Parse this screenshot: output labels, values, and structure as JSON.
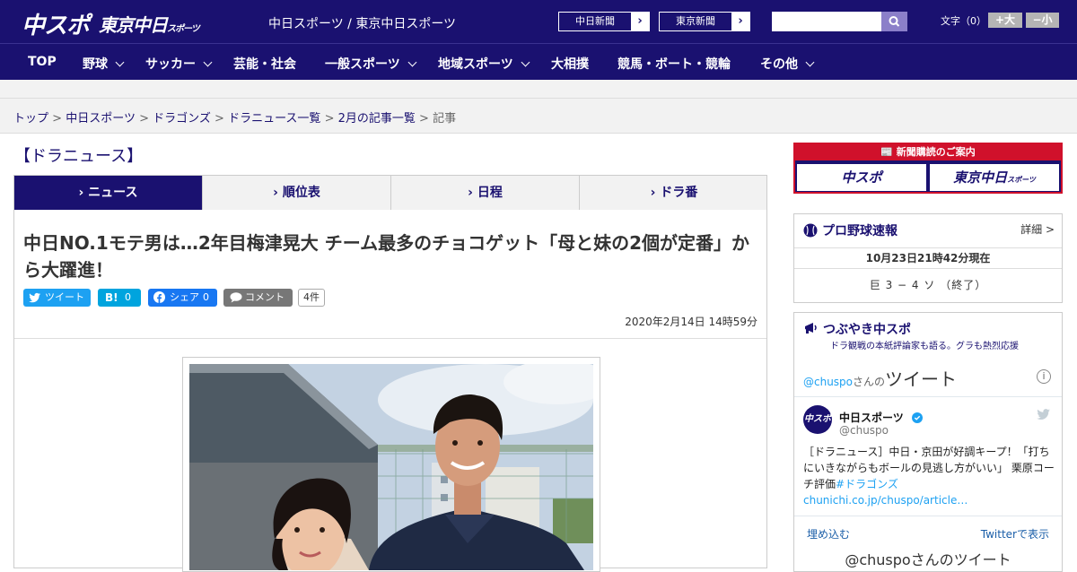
{
  "header": {
    "logo_main": "中スポ",
    "logo_sub": "東京中日",
    "logo_sub_small": "スポーツ",
    "tagline": "中日スポーツ / 東京中日スポーツ",
    "paper_links": [
      "中日新聞",
      "東京新聞"
    ],
    "search_placeholder": "",
    "font_size_label": "文字（0）",
    "font_larger": "+大",
    "font_smaller": "−小"
  },
  "nav": {
    "items": [
      {
        "label": "TOP",
        "has_menu": false
      },
      {
        "label": "野球",
        "has_menu": true
      },
      {
        "label": "サッカー",
        "has_menu": true
      },
      {
        "label": "芸能・社会",
        "has_menu": false
      },
      {
        "label": "一般スポーツ",
        "has_menu": true
      },
      {
        "label": "地域スポーツ",
        "has_menu": true
      },
      {
        "label": "大相撲",
        "has_menu": false
      },
      {
        "label": "競馬・ボート・競輪",
        "has_menu": false
      },
      {
        "label": "その他",
        "has_menu": true
      }
    ]
  },
  "breadcrumb": {
    "items": [
      "トップ",
      "中日スポーツ",
      "ドラゴンズ",
      "ドラニュース一覧",
      "2月の記事一覧"
    ],
    "current": "記事",
    "separator": ">"
  },
  "section_title": "【ドラニュース】",
  "tabs": [
    "ニュース",
    "順位表",
    "日程",
    "ドラ番"
  ],
  "article": {
    "headline": "中日NO.1モテ男は…2年目梅津晃大 チーム最多のチョコゲット「母と妹の2個が定番」から大躍進！",
    "share": {
      "tweet": "ツイート",
      "hatena_count": "0",
      "facebook": "シェア",
      "facebook_count": "0",
      "comment": "コメント",
      "comment_count": "4件"
    },
    "date": "2020年2月14日 14時59分"
  },
  "sidebar": {
    "banner_title": "新聞購読のご案内",
    "banner_papers": [
      "中スポ",
      "東京中日"
    ],
    "banner_sub": "スポーツ",
    "baseball": {
      "title": "プロ野球速報",
      "detail": "詳細 >",
      "updated": "10月23日21時42分現在",
      "score": "巨 3 − 4 ソ （終了）"
    },
    "tweets": {
      "title": "つぶやき中スポ",
      "subtitle": "ドラ観戦の本紙評論家も語る。グラも熱烈応援",
      "handle_prefix": "@chuspo",
      "handle_suffix": "さんの",
      "heading": "ツイート",
      "account_name": "中日スポーツ",
      "account_handle": "@chuspo",
      "tweet_text": "［ドラニュース］中日・京田が好調キープ！「打ちにいきながらもボールの見逃し方がいい」 栗原コーチ評価",
      "tweet_link": "#ドラゴンズchunichi.co.jp/chuspo/article…",
      "embed": "埋め込む",
      "view_on_twitter": "Twitterで表示",
      "footer": "@chuspoさんのツイート"
    }
  },
  "colors": {
    "brand": "#1a1170",
    "accent_red": "#d0112b",
    "twitter": "#1da1f2",
    "facebook": "#1877f2",
    "hatena": "#00a4de"
  }
}
